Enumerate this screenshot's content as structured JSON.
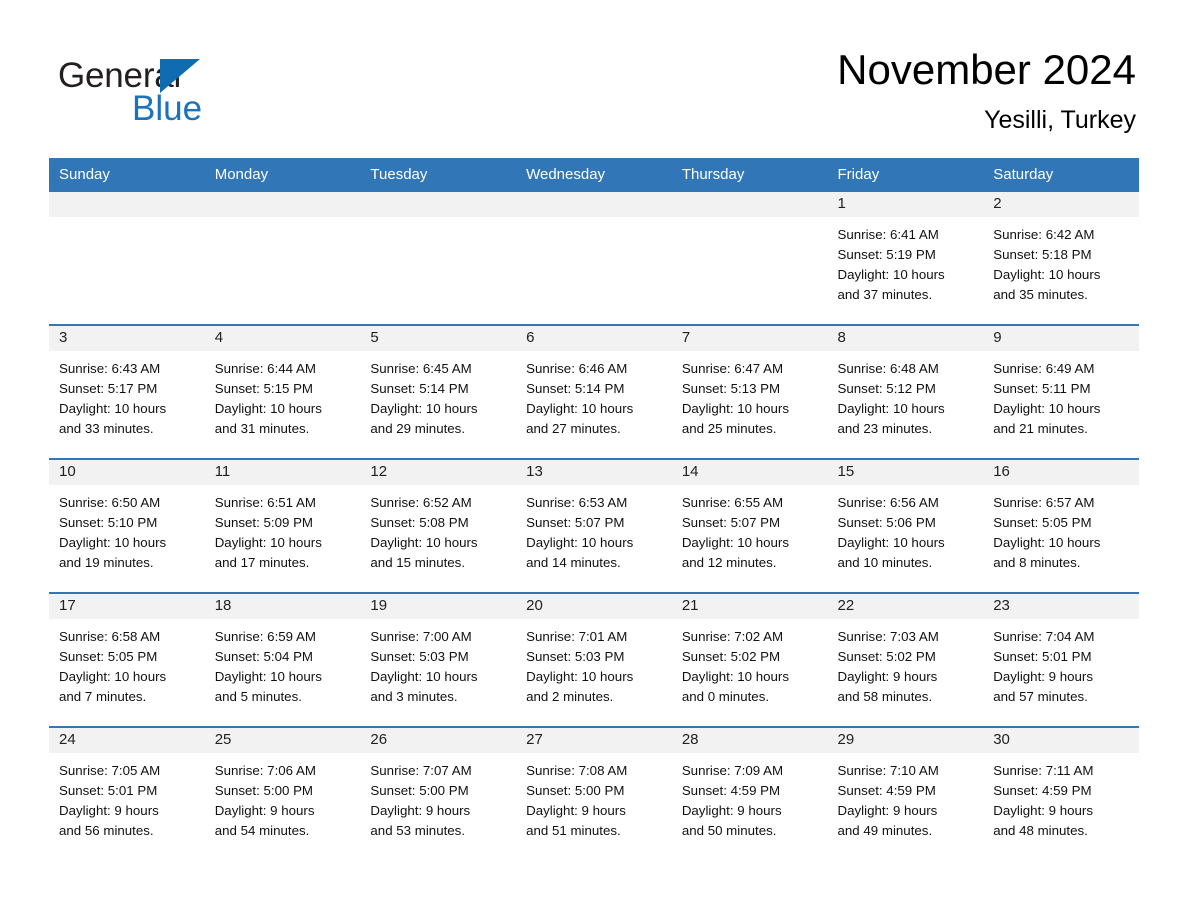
{
  "brand": {
    "name_part1": "General",
    "name_part2": "Blue",
    "triangle_color": "#0f6cb0",
    "blue_color": "#1b74bb"
  },
  "header": {
    "month_title": "November 2024",
    "location": "Yesilli, Turkey"
  },
  "theme": {
    "header_blue": "#3176b6",
    "daynum_bg": "#f2f2f2",
    "row_divider": "#3176b6"
  },
  "weekday_headers": [
    "Sunday",
    "Monday",
    "Tuesday",
    "Wednesday",
    "Thursday",
    "Friday",
    "Saturday"
  ],
  "labels": {
    "sunrise_prefix": "Sunrise:",
    "sunset_prefix": "Sunset:",
    "daylight_prefix": "Daylight:"
  },
  "weeks": [
    [
      {
        "day": "",
        "empty": true
      },
      {
        "day": "",
        "empty": true
      },
      {
        "day": "",
        "empty": true
      },
      {
        "day": "",
        "empty": true
      },
      {
        "day": "",
        "empty": true
      },
      {
        "day": "1",
        "sunrise": "Sunrise: 6:41 AM",
        "sunset": "Sunset: 5:19 PM",
        "daylight_line1": "Daylight: 10 hours",
        "daylight_line2": "and 37 minutes."
      },
      {
        "day": "2",
        "sunrise": "Sunrise: 6:42 AM",
        "sunset": "Sunset: 5:18 PM",
        "daylight_line1": "Daylight: 10 hours",
        "daylight_line2": "and 35 minutes."
      }
    ],
    [
      {
        "day": "3",
        "sunrise": "Sunrise: 6:43 AM",
        "sunset": "Sunset: 5:17 PM",
        "daylight_line1": "Daylight: 10 hours",
        "daylight_line2": "and 33 minutes."
      },
      {
        "day": "4",
        "sunrise": "Sunrise: 6:44 AM",
        "sunset": "Sunset: 5:15 PM",
        "daylight_line1": "Daylight: 10 hours",
        "daylight_line2": "and 31 minutes."
      },
      {
        "day": "5",
        "sunrise": "Sunrise: 6:45 AM",
        "sunset": "Sunset: 5:14 PM",
        "daylight_line1": "Daylight: 10 hours",
        "daylight_line2": "and 29 minutes."
      },
      {
        "day": "6",
        "sunrise": "Sunrise: 6:46 AM",
        "sunset": "Sunset: 5:14 PM",
        "daylight_line1": "Daylight: 10 hours",
        "daylight_line2": "and 27 minutes."
      },
      {
        "day": "7",
        "sunrise": "Sunrise: 6:47 AM",
        "sunset": "Sunset: 5:13 PM",
        "daylight_line1": "Daylight: 10 hours",
        "daylight_line2": "and 25 minutes."
      },
      {
        "day": "8",
        "sunrise": "Sunrise: 6:48 AM",
        "sunset": "Sunset: 5:12 PM",
        "daylight_line1": "Daylight: 10 hours",
        "daylight_line2": "and 23 minutes."
      },
      {
        "day": "9",
        "sunrise": "Sunrise: 6:49 AM",
        "sunset": "Sunset: 5:11 PM",
        "daylight_line1": "Daylight: 10 hours",
        "daylight_line2": "and 21 minutes."
      }
    ],
    [
      {
        "day": "10",
        "sunrise": "Sunrise: 6:50 AM",
        "sunset": "Sunset: 5:10 PM",
        "daylight_line1": "Daylight: 10 hours",
        "daylight_line2": "and 19 minutes."
      },
      {
        "day": "11",
        "sunrise": "Sunrise: 6:51 AM",
        "sunset": "Sunset: 5:09 PM",
        "daylight_line1": "Daylight: 10 hours",
        "daylight_line2": "and 17 minutes."
      },
      {
        "day": "12",
        "sunrise": "Sunrise: 6:52 AM",
        "sunset": "Sunset: 5:08 PM",
        "daylight_line1": "Daylight: 10 hours",
        "daylight_line2": "and 15 minutes."
      },
      {
        "day": "13",
        "sunrise": "Sunrise: 6:53 AM",
        "sunset": "Sunset: 5:07 PM",
        "daylight_line1": "Daylight: 10 hours",
        "daylight_line2": "and 14 minutes."
      },
      {
        "day": "14",
        "sunrise": "Sunrise: 6:55 AM",
        "sunset": "Sunset: 5:07 PM",
        "daylight_line1": "Daylight: 10 hours",
        "daylight_line2": "and 12 minutes."
      },
      {
        "day": "15",
        "sunrise": "Sunrise: 6:56 AM",
        "sunset": "Sunset: 5:06 PM",
        "daylight_line1": "Daylight: 10 hours",
        "daylight_line2": "and 10 minutes."
      },
      {
        "day": "16",
        "sunrise": "Sunrise: 6:57 AM",
        "sunset": "Sunset: 5:05 PM",
        "daylight_line1": "Daylight: 10 hours",
        "daylight_line2": "and 8 minutes."
      }
    ],
    [
      {
        "day": "17",
        "sunrise": "Sunrise: 6:58 AM",
        "sunset": "Sunset: 5:05 PM",
        "daylight_line1": "Daylight: 10 hours",
        "daylight_line2": "and 7 minutes."
      },
      {
        "day": "18",
        "sunrise": "Sunrise: 6:59 AM",
        "sunset": "Sunset: 5:04 PM",
        "daylight_line1": "Daylight: 10 hours",
        "daylight_line2": "and 5 minutes."
      },
      {
        "day": "19",
        "sunrise": "Sunrise: 7:00 AM",
        "sunset": "Sunset: 5:03 PM",
        "daylight_line1": "Daylight: 10 hours",
        "daylight_line2": "and 3 minutes."
      },
      {
        "day": "20",
        "sunrise": "Sunrise: 7:01 AM",
        "sunset": "Sunset: 5:03 PM",
        "daylight_line1": "Daylight: 10 hours",
        "daylight_line2": "and 2 minutes."
      },
      {
        "day": "21",
        "sunrise": "Sunrise: 7:02 AM",
        "sunset": "Sunset: 5:02 PM",
        "daylight_line1": "Daylight: 10 hours",
        "daylight_line2": "and 0 minutes."
      },
      {
        "day": "22",
        "sunrise": "Sunrise: 7:03 AM",
        "sunset": "Sunset: 5:02 PM",
        "daylight_line1": "Daylight: 9 hours",
        "daylight_line2": "and 58 minutes."
      },
      {
        "day": "23",
        "sunrise": "Sunrise: 7:04 AM",
        "sunset": "Sunset: 5:01 PM",
        "daylight_line1": "Daylight: 9 hours",
        "daylight_line2": "and 57 minutes."
      }
    ],
    [
      {
        "day": "24",
        "sunrise": "Sunrise: 7:05 AM",
        "sunset": "Sunset: 5:01 PM",
        "daylight_line1": "Daylight: 9 hours",
        "daylight_line2": "and 56 minutes."
      },
      {
        "day": "25",
        "sunrise": "Sunrise: 7:06 AM",
        "sunset": "Sunset: 5:00 PM",
        "daylight_line1": "Daylight: 9 hours",
        "daylight_line2": "and 54 minutes."
      },
      {
        "day": "26",
        "sunrise": "Sunrise: 7:07 AM",
        "sunset": "Sunset: 5:00 PM",
        "daylight_line1": "Daylight: 9 hours",
        "daylight_line2": "and 53 minutes."
      },
      {
        "day": "27",
        "sunrise": "Sunrise: 7:08 AM",
        "sunset": "Sunset: 5:00 PM",
        "daylight_line1": "Daylight: 9 hours",
        "daylight_line2": "and 51 minutes."
      },
      {
        "day": "28",
        "sunrise": "Sunrise: 7:09 AM",
        "sunset": "Sunset: 4:59 PM",
        "daylight_line1": "Daylight: 9 hours",
        "daylight_line2": "and 50 minutes."
      },
      {
        "day": "29",
        "sunrise": "Sunrise: 7:10 AM",
        "sunset": "Sunset: 4:59 PM",
        "daylight_line1": "Daylight: 9 hours",
        "daylight_line2": "and 49 minutes."
      },
      {
        "day": "30",
        "sunrise": "Sunrise: 7:11 AM",
        "sunset": "Sunset: 4:59 PM",
        "daylight_line1": "Daylight: 9 hours",
        "daylight_line2": "and 48 minutes."
      }
    ]
  ]
}
